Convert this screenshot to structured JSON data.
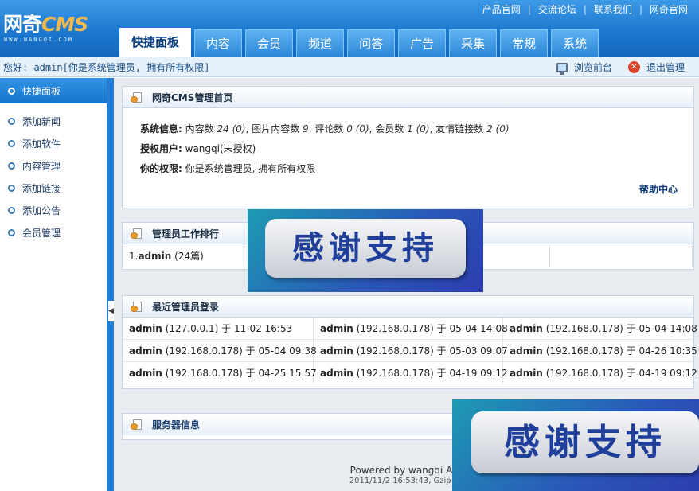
{
  "brand": {
    "logo_main": "网奇",
    "logo_cms": "CMS",
    "logo_sub": "WWW.WANGQI.COM"
  },
  "toplinks": [
    "产品官网",
    "交流论坛",
    "联系我们",
    "网奇官网"
  ],
  "tabs": [
    "快捷面板",
    "内容",
    "会员",
    "频道",
    "问答",
    "广告",
    "采集",
    "常规",
    "系统"
  ],
  "subbar": {
    "welcome": "您好: admin[你是系统管理员, 拥有所有权限]",
    "browse_front": "浏览前台",
    "logout": "退出管理"
  },
  "sidebar": {
    "header": "快捷面板",
    "items": [
      "添加新闻",
      "添加软件",
      "内容管理",
      "添加链接",
      "添加公告",
      "会员管理"
    ]
  },
  "home_panel": {
    "title": "网奇CMS管理首页",
    "sys_label": "系统信息:",
    "sys_content_label": "内容数",
    "sys_content_val": "24 (0)",
    "sys_pic_label": "图片内容数",
    "sys_pic_val": "9",
    "sys_comment_label": "评论数",
    "sys_comment_val": "0 (0)",
    "sys_member_label": "会员数",
    "sys_member_val": "1 (0)",
    "sys_link_label": "友情链接数",
    "sys_link_val": "2 (0)",
    "auth_label": "授权用户:",
    "auth_value": "wangqi(未授权)",
    "perm_label": "你的权限:",
    "perm_value": "你是系统管理员, 拥有所有权限",
    "help": "帮助中心"
  },
  "rank_panel": {
    "title": "管理员工作排行",
    "entries": [
      {
        "rank": "1.",
        "name": "admin",
        "count": "(24篇)"
      }
    ]
  },
  "login_panel": {
    "title": "最近管理员登录",
    "entries": [
      {
        "user": "admin",
        "ip": "(127.0.0.1)",
        "time": "于 11-02 16:53"
      },
      {
        "user": "admin",
        "ip": "(192.168.0.178)",
        "time": "于 05-04 14:08"
      },
      {
        "user": "admin",
        "ip": "(192.168.0.178)",
        "time": "于 05-04 14:08"
      },
      {
        "user": "admin",
        "ip": "(192.168.0.178)",
        "time": "于 05-04 09:38"
      },
      {
        "user": "admin",
        "ip": "(192.168.0.178)",
        "time": "于 05-03 09:07"
      },
      {
        "user": "admin",
        "ip": "(192.168.0.178)",
        "time": "于 04-26 10:35"
      },
      {
        "user": "admin",
        "ip": "(192.168.0.178)",
        "time": "于 04-25 15:57"
      },
      {
        "user": "admin",
        "ip": "(192.168.0.178)",
        "time": "于 04-19 09:12"
      },
      {
        "user": "admin",
        "ip": "(192.168.0.178)",
        "time": "于 04-19 09:12"
      }
    ]
  },
  "server_panel": {
    "title": "服务器信息"
  },
  "footer": {
    "line1": "Powered by wangqi Acc",
    "line2": "2011/11/2 16:53:43, Gzip en"
  },
  "overlay": {
    "stamp1": "感谢支持",
    "stamp2": "感谢支持"
  },
  "colors": {
    "header_blue": "#1c78cf",
    "accent_blue": "#1574cc",
    "logo_orange": "#f7b94a",
    "help_link": "#0d3a78"
  }
}
